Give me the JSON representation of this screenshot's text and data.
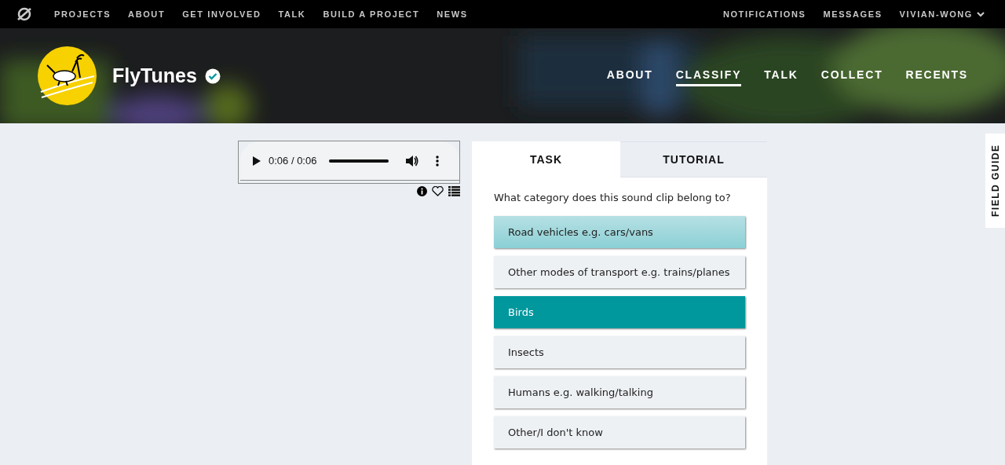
{
  "top_nav": {
    "links": [
      "PROJECTS",
      "ABOUT",
      "GET INVOLVED",
      "TALK",
      "BUILD A PROJECT",
      "NEWS"
    ],
    "user_links": [
      "NOTIFICATIONS",
      "MESSAGES"
    ],
    "user_menu": "VIVIAN-WONG"
  },
  "project": {
    "title": "FlyTunes",
    "verified": true,
    "nav": [
      {
        "label": "ABOUT",
        "selected": false
      },
      {
        "label": "CLASSIFY",
        "selected": true
      },
      {
        "label": "TALK",
        "selected": false
      },
      {
        "label": "COLLECT",
        "selected": false
      },
      {
        "label": "RECENTS",
        "selected": false
      }
    ]
  },
  "audio_player": {
    "time": "0:06 / 0:06",
    "level": 1
  },
  "task_panel": {
    "tabs": [
      {
        "label": "TASK",
        "selected": true
      },
      {
        "label": "TUTORIAL",
        "selected": false
      }
    ],
    "question": "What category does this sound clip belong to?",
    "answers": [
      {
        "label": "Road vehicles e.g. cars/vans",
        "selected": false,
        "hovered": true
      },
      {
        "label": "Other modes of transport e.g. trains/planes",
        "selected": false,
        "hovered": false
      },
      {
        "label": "Birds",
        "selected": true,
        "hovered": false
      },
      {
        "label": "Insects",
        "selected": false,
        "hovered": false
      },
      {
        "label": "Humans e.g. walking/talking",
        "selected": false,
        "hovered": false
      },
      {
        "label": "Other/I don't know",
        "selected": false,
        "hovered": false
      }
    ]
  },
  "field_guide": {
    "label": "FIELD GUIDE"
  }
}
